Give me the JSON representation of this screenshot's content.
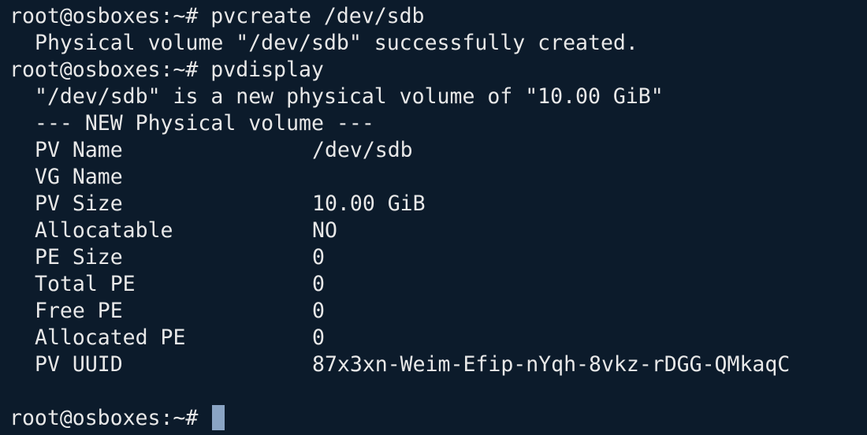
{
  "terminal": {
    "prompt": "root@osboxes:~# ",
    "commands": {
      "pvcreate": "pvcreate /dev/sdb",
      "pvdisplay": "pvdisplay"
    },
    "pvcreate_output": "Physical volume \"/dev/sdb\" successfully created.",
    "pvdisplay_intro": "\"/dev/sdb\" is a new physical volume of \"10.00 GiB\"",
    "pvdisplay_header": "--- NEW Physical volume ---",
    "fields": [
      {
        "label": "PV Name",
        "value": "/dev/sdb"
      },
      {
        "label": "VG Name",
        "value": ""
      },
      {
        "label": "PV Size",
        "value": "10.00 GiB"
      },
      {
        "label": "Allocatable",
        "value": "NO"
      },
      {
        "label": "PE Size",
        "value": "0"
      },
      {
        "label": "Total PE",
        "value": "0"
      },
      {
        "label": "Free PE",
        "value": "0"
      },
      {
        "label": "Allocated PE",
        "value": "0"
      },
      {
        "label": "PV UUID",
        "value": "87x3xn-Weim-Efip-nYqh-8vkz-rDGG-QMkaqC"
      }
    ]
  },
  "colors": {
    "background": "#0c1b2b",
    "text": "#e8e8e8",
    "cursor": "#8aa4c4"
  }
}
